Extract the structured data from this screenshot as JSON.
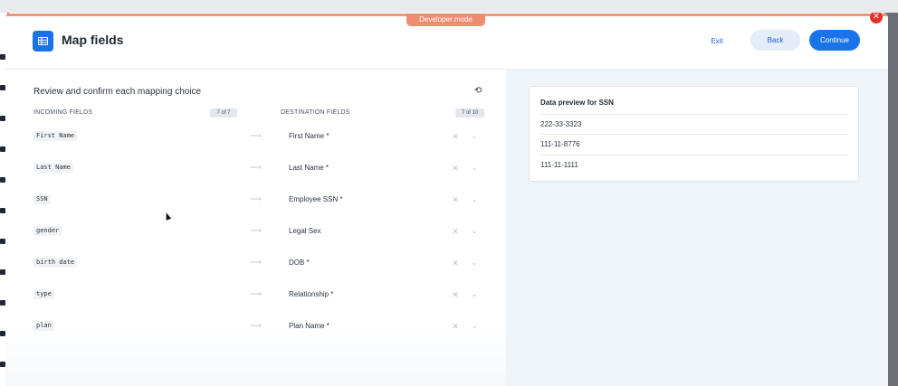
{
  "banner": {
    "label": "Developer mode"
  },
  "header": {
    "title": "Map fields",
    "exit_label": "Exit",
    "back_label": "Back",
    "continue_label": "Continue"
  },
  "mapping": {
    "section_title": "Review and confirm each mapping choice",
    "incoming_header": "INCOMING FIELDS",
    "incoming_count": "7 of 7",
    "destination_header": "DESTINATION FIELDS",
    "destination_count": "7 of 10",
    "rows": [
      {
        "incoming": "First Name",
        "destination": "First Name *"
      },
      {
        "incoming": "Last Name",
        "destination": "Last Name *"
      },
      {
        "incoming": "SSN",
        "destination": "Employee SSN *"
      },
      {
        "incoming": "gender",
        "destination": "Legal Sex"
      },
      {
        "incoming": "birth date",
        "destination": "DOB *"
      },
      {
        "incoming": "type",
        "destination": "Relationship *"
      },
      {
        "incoming": "plan",
        "destination": "Plan Name *"
      }
    ]
  },
  "preview": {
    "title": "Data preview for SSN",
    "values": [
      "222-33-3323",
      "111-11-8776",
      "111-11-1111"
    ]
  },
  "colors": {
    "accent": "#1a73e8",
    "developer_banner": "#ef8c70",
    "close": "#e5332a"
  },
  "icons": [
    "table-icon",
    "reset-icon",
    "arrow-right-icon",
    "clear-icon",
    "chevron-down-icon",
    "close-icon"
  ]
}
